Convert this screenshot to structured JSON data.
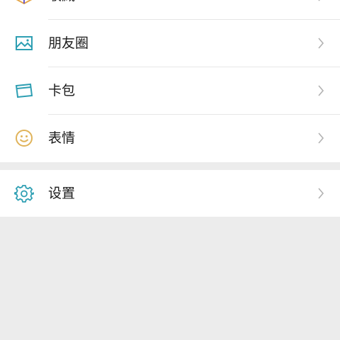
{
  "menu": {
    "items": [
      {
        "label": "收藏",
        "icon": "favorites-cube-icon"
      },
      {
        "label": "朋友圈",
        "icon": "moments-image-icon"
      },
      {
        "label": "卡包",
        "icon": "card-wallet-icon"
      },
      {
        "label": "表情",
        "icon": "smiley-face-icon"
      }
    ],
    "settings": {
      "label": "设置",
      "icon": "gear-icon"
    }
  },
  "colors": {
    "background": "#ececec",
    "row_background": "#ffffff",
    "icon_teal": "#2e9fb3",
    "icon_gold": "#e0b35a",
    "chevron": "#b2b2b2",
    "divider": "#e6e6e6"
  }
}
